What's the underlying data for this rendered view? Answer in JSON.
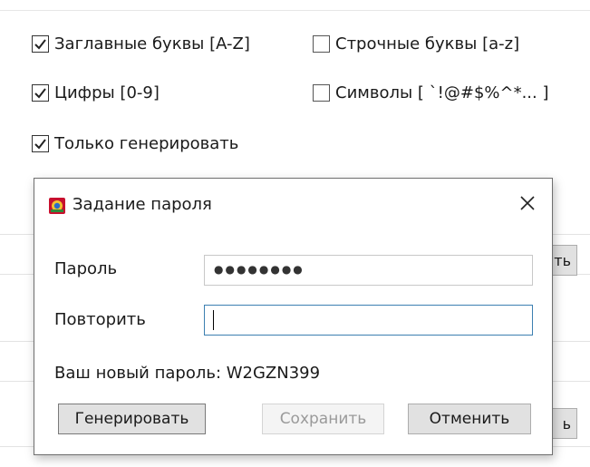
{
  "options": {
    "uppercase": {
      "label": "Заглавные буквы [A-Z]",
      "checked": true
    },
    "lowercase": {
      "label": "Строчные буквы [a-z]",
      "checked": false
    },
    "digits": {
      "label": "Цифры [0-9]",
      "checked": true
    },
    "symbols": {
      "label": "Символы [ `!@#$%^*... ]",
      "checked": false
    },
    "generate_only": {
      "label": "Только генерировать",
      "checked": true
    }
  },
  "background": {
    "button1_label": "ть",
    "button2_label": "ь"
  },
  "dialog": {
    "title": "Задание пароля",
    "password_label": "Пароль",
    "password_mask": "●●●●●●●●",
    "repeat_label": "Повторить",
    "repeat_value": "",
    "new_password_text": "Ваш новый пароль: W2GZN399",
    "buttons": {
      "generate": "Генерировать",
      "save": "Сохранить",
      "cancel": "Отменить"
    }
  },
  "colors": {
    "focus_border": "#3c7fb1",
    "disabled_text": "#9a9a9a"
  },
  "icons": {
    "app": "app-icon",
    "close": "close-icon",
    "check": "checkmark-icon"
  }
}
